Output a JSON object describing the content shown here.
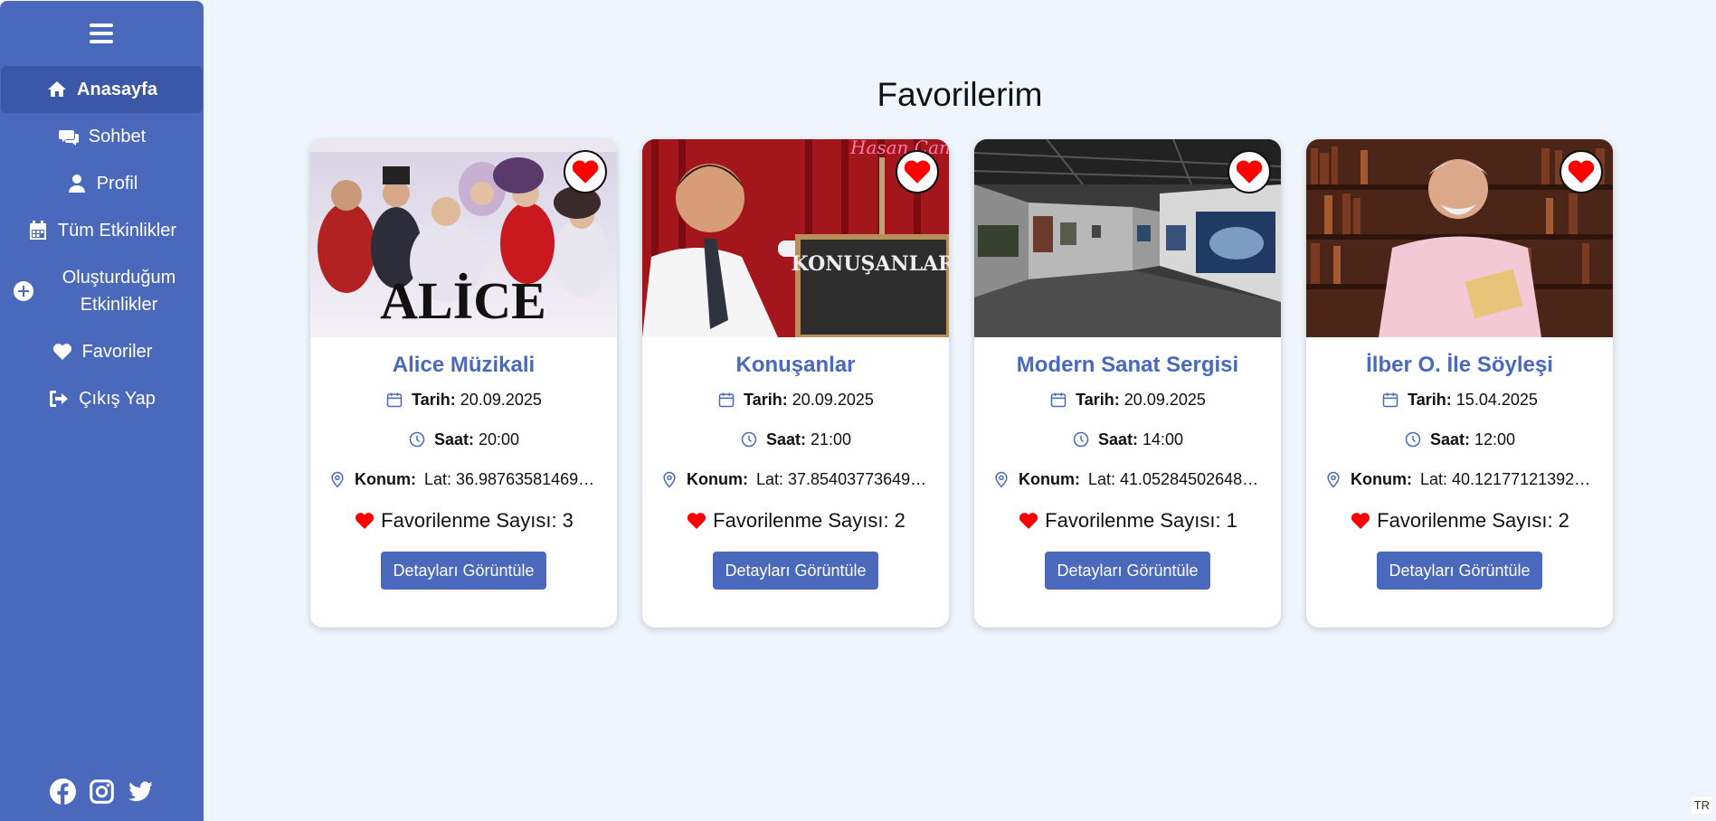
{
  "sidebar": {
    "items": [
      {
        "label": "Anasayfa",
        "icon": "home-icon"
      },
      {
        "label": "Sohbet",
        "icon": "comments-icon"
      },
      {
        "label": "Profil",
        "icon": "user-icon"
      },
      {
        "label": "Tüm Etkinlikler",
        "icon": "calendar-icon"
      },
      {
        "label": "Oluşturduğum Etkinlikler",
        "icon": "plus-circle-icon"
      },
      {
        "label": "Favoriler",
        "icon": "heart-icon"
      },
      {
        "label": "Çıkış Yap",
        "icon": "sign-out-icon"
      }
    ],
    "social": [
      "facebook-icon",
      "instagram-icon",
      "twitter-icon"
    ]
  },
  "page": {
    "title": "Favorilerim"
  },
  "labels": {
    "date": "Tarih:",
    "time": "Saat:",
    "location": "Konum:",
    "fav_count": "Favorilenme Sayısı:",
    "details_button": "Detayları Görüntüle"
  },
  "cards": [
    {
      "title": "Alice Müzikali",
      "date": "20.09.2025",
      "time": "20:00",
      "location": "Lat: 36.987635814697…",
      "fav_count": "3"
    },
    {
      "title": "Konuşanlar",
      "date": "20.09.2025",
      "time": "21:00",
      "location": "Lat: 37.854037736495…",
      "fav_count": "2"
    },
    {
      "title": "Modern Sanat Sergisi",
      "date": "20.09.2025",
      "time": "14:00",
      "location": "Lat: 41.052845026482…",
      "fav_count": "1"
    },
    {
      "title": "İlber O. İle Söyleşi",
      "date": "15.04.2025",
      "time": "12:00",
      "location": "Lat: 40.121771213926…",
      "fav_count": "2"
    }
  ],
  "image_text": {
    "alice": "ALİCE",
    "konusanlar": "KONUŞANLAR",
    "konusanlar_sign": "Hasan Can Kaya"
  },
  "lang_badge": "TR",
  "colors": {
    "accent": "#4a69bd",
    "heart": "#ff0000",
    "background": "#eef5fd"
  }
}
